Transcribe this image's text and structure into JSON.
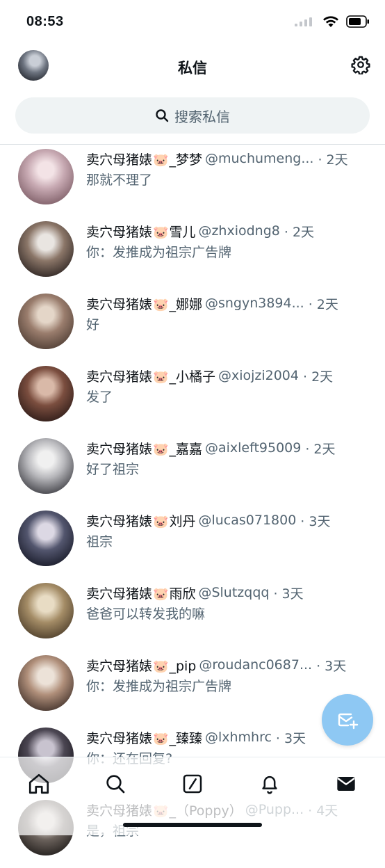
{
  "status": {
    "time": "08:53"
  },
  "header": {
    "title": "私信",
    "avatar_icon": "profile-avatar",
    "settings_icon": "gear-icon"
  },
  "search": {
    "placeholder": "搜索私信"
  },
  "conversations": [
    {
      "prefix": "卖穴母猪婊",
      "suffix": "_梦梦",
      "handle": "@muchumeng...",
      "time": "· 2天",
      "message": "那就不理了",
      "avatar_colors": [
        "#f3e3e6",
        "#c7a9b2",
        "#7a5a63"
      ]
    },
    {
      "prefix": "卖穴母猪婊",
      "suffix": "雪儿",
      "handle": "@zhxiodng8",
      "time": "· 2天",
      "message": "你：发推成为祖宗广告牌",
      "avatar_colors": [
        "#e9e5e1",
        "#8b7668",
        "#2a2220"
      ]
    },
    {
      "prefix": "卖穴母猪婊",
      "suffix": "_娜娜",
      "handle": "@sngyn3894...",
      "time": "· 2天",
      "message": "好",
      "avatar_colors": [
        "#e4d6c8",
        "#9a7d6d",
        "#4c3b32"
      ]
    },
    {
      "prefix": "卖穴母猪婊",
      "suffix": "_小橘子",
      "handle": "@xiojzi2004",
      "time": "· 2天",
      "message": "发了",
      "avatar_colors": [
        "#d9b9a8",
        "#7b4e3f",
        "#2b1a17"
      ]
    },
    {
      "prefix": "卖穴母猪婊",
      "suffix": "_嘉嘉",
      "handle": "@aixleft95009",
      "time": "· 2天",
      "message": "好了祖宗",
      "avatar_colors": [
        "#f0f0f0",
        "#b8b8bc",
        "#3a3a40"
      ]
    },
    {
      "prefix": "卖穴母猪婊",
      "suffix": "刘丹",
      "handle": "@lucas071800",
      "time": "· 3天",
      "message": "祖宗",
      "avatar_colors": [
        "#dcd8e4",
        "#53566e",
        "#161826"
      ]
    },
    {
      "prefix": "卖穴母猪婊",
      "suffix": "雨欣",
      "handle": "@Slutzqqq",
      "time": "· 3天",
      "message": "爸爸可以转发我的嘛",
      "avatar_colors": [
        "#e8dcc4",
        "#a48c66",
        "#4a3b28"
      ]
    },
    {
      "prefix": "卖穴母猪婊",
      "suffix": "_pip",
      "handle": "@roudanc0687...",
      "time": "· 3天",
      "message": "你：发推成为祖宗广告牌",
      "avatar_colors": [
        "#ece2d8",
        "#b08f7a",
        "#3e2f29"
      ]
    },
    {
      "prefix": "卖穴母猪婊",
      "suffix": "_臻臻",
      "handle": "@lxhmhrc",
      "time": "· 3天",
      "message": "你：还在回复?",
      "avatar_colors": [
        "#c8c3cf",
        "#4c4753",
        "#121016"
      ]
    },
    {
      "prefix": "卖穴母猪婊",
      "suffix": "_（Poppy）",
      "handle": "@Pupp...",
      "time": "· 4天",
      "message": "是，祖宗",
      "avatar_colors": [
        "#d0c9c3",
        "#6b625c",
        "#1f1b19"
      ]
    }
  ],
  "fab": {
    "icon": "new-message-icon"
  },
  "tabbar": {
    "items": [
      "home-icon",
      "search-icon",
      "compose-icon",
      "bell-icon",
      "mail-icon"
    ],
    "active": "mail-icon"
  },
  "colors": {
    "accent": "#1d9bf0",
    "fab": "#8ec8f3",
    "muted_text": "#536471",
    "search_bg": "#eff3f4"
  }
}
